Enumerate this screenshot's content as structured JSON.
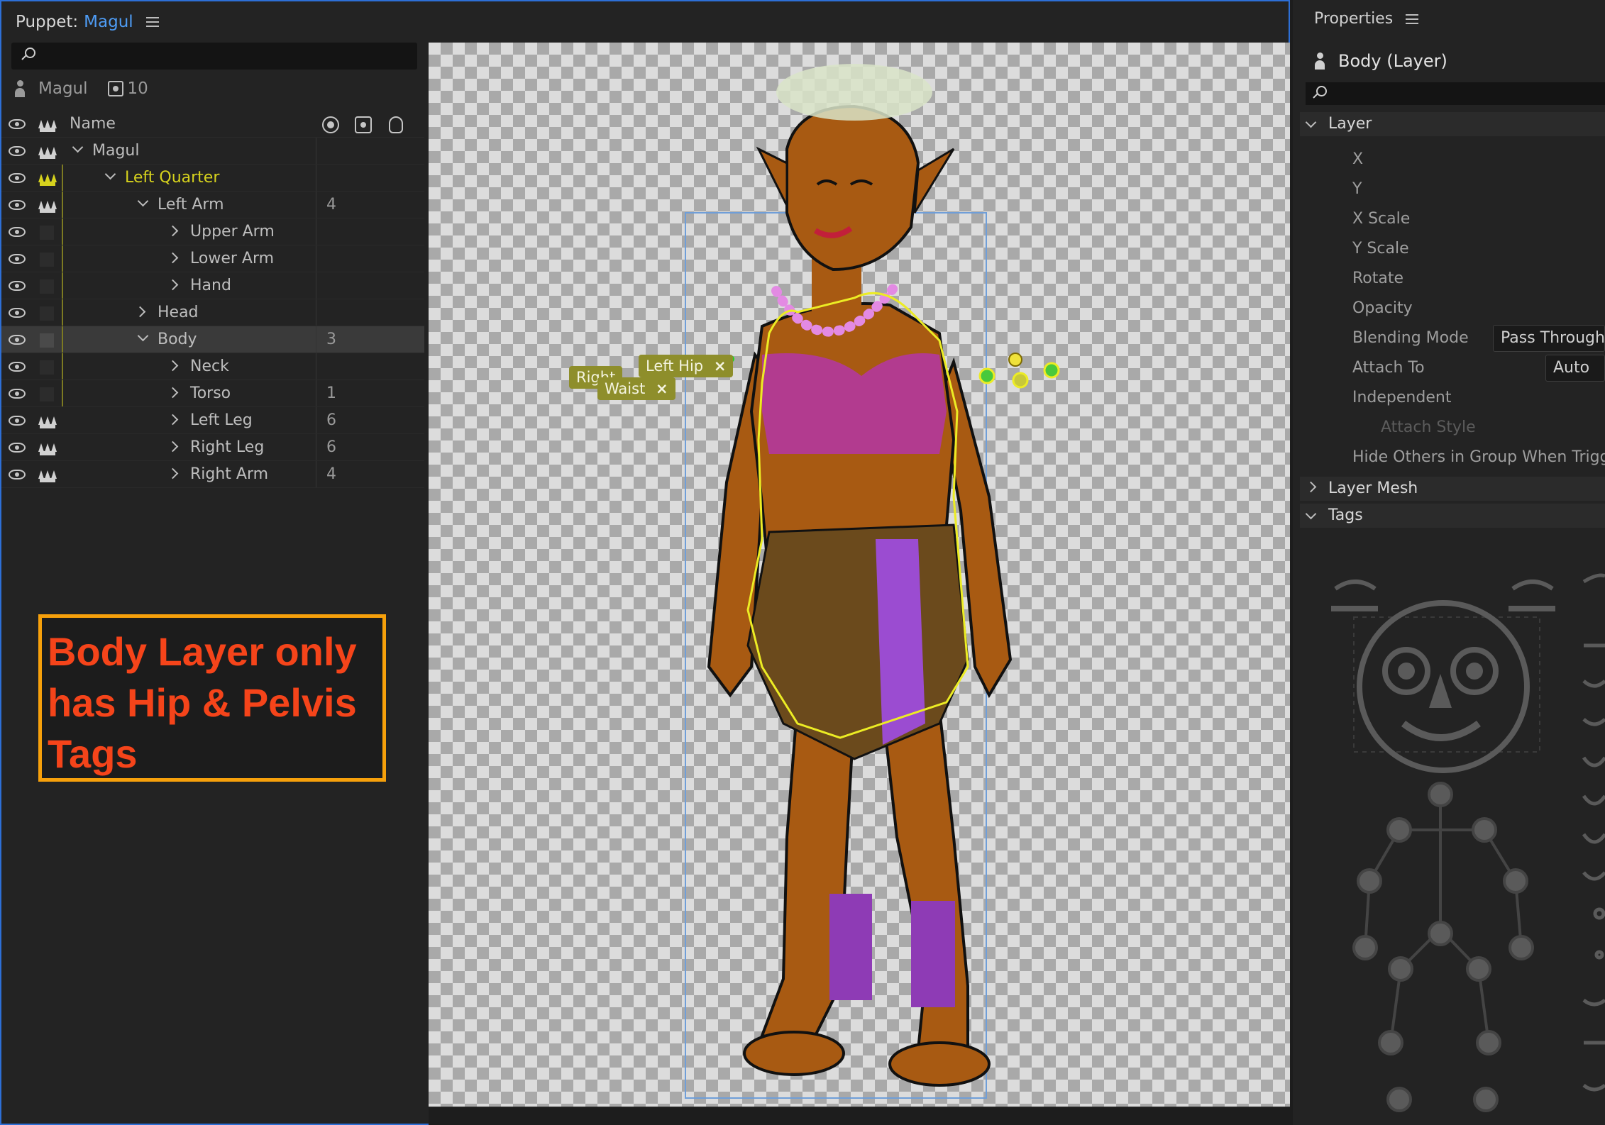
{
  "puppet_panel": {
    "title_prefix": "Puppet:",
    "title_name": "Magul",
    "puppet_name": "Magul",
    "handle_count": "10",
    "column_name": "Name",
    "tree": [
      {
        "label": "Magul",
        "count": ""
      },
      {
        "label": "Left Quarter",
        "count": ""
      },
      {
        "label": "Left Arm",
        "count": "4"
      },
      {
        "label": "Upper Arm",
        "count": ""
      },
      {
        "label": "Lower Arm",
        "count": ""
      },
      {
        "label": "Hand",
        "count": ""
      },
      {
        "label": "Head",
        "count": ""
      },
      {
        "label": "Body",
        "count": "3"
      },
      {
        "label": "Neck",
        "count": ""
      },
      {
        "label": "Torso",
        "count": "1"
      },
      {
        "label": "Left Leg",
        "count": "6"
      },
      {
        "label": "Right Leg",
        "count": "6"
      },
      {
        "label": "Right Arm",
        "count": "4"
      }
    ]
  },
  "annotation": {
    "text": "Body Layer only\nhas Hip & Pelvis\nTags"
  },
  "stage": {
    "tags": [
      {
        "label": "Right",
        "close": "×"
      },
      {
        "label": "Waist",
        "close": "×"
      },
      {
        "label": "Left Hip",
        "close": "×"
      }
    ]
  },
  "properties": {
    "title": "Properties",
    "layer_name": "Body (Layer)",
    "sections": {
      "layer": "Layer",
      "layer_mesh": "Layer Mesh",
      "tags": "Tags"
    },
    "rows": {
      "x": "X",
      "y": "Y",
      "x_scale": "X Scale",
      "y_scale": "Y Scale",
      "rotate": "Rotate",
      "opacity": "Opacity",
      "blending_mode": "Blending Mode",
      "attach_to": "Attach To",
      "independent": "Independent",
      "attach_style": "Attach Style",
      "hide_others": "Hide Others in Group When Triggered"
    },
    "values": {
      "blending_mode": "Pass Through",
      "attach_to": "Auto"
    }
  },
  "colors": {
    "selection_blue": "#2d6fd6",
    "group_yellow": "#d6d21d",
    "annotation_border": "#f6a00b",
    "annotation_text": "#f5441a"
  }
}
